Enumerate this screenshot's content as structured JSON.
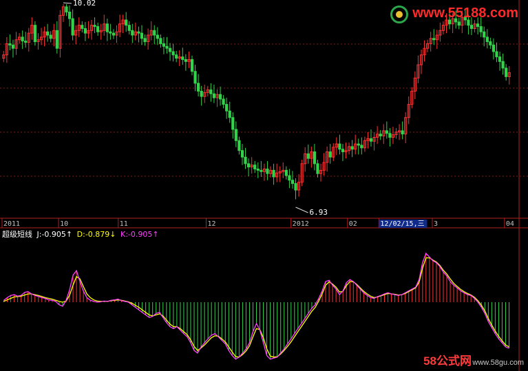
{
  "watermarks": {
    "top_site": "www.55188.com",
    "bottom_brand": "58公式网",
    "bottom_site": "www.58gu.com"
  },
  "indicator": {
    "name": "超级短线",
    "j_label": "J:-0.905↑",
    "d_label": "D:-0.879↓",
    "k_label": "K:-0.905↑"
  },
  "colors": {
    "background": "#000000",
    "up": "#ff3232",
    "down": "#32d24a",
    "grid": "#8b1a1a",
    "j_line": "#ffffff",
    "d_line": "#ffff00",
    "k_line": "#ff40ff",
    "axis_text": "#c0c0c0"
  },
  "chart_data": [
    {
      "type": "candlestick",
      "annotations": [
        {
          "label": "10.02",
          "kind": "max"
        },
        {
          "label": "6.93",
          "kind": "min"
        }
      ],
      "x_tick_labels": [
        "2011",
        "10",
        "11",
        "12",
        "2012",
        "02",
        "12/02/15,三",
        "3",
        "04"
      ],
      "x_tick_index": [
        0,
        18,
        37,
        65,
        92,
        110,
        120,
        137,
        160
      ],
      "highlighted_tick": "12/02/15,三",
      "close": [
        9.25,
        9.42,
        9.4,
        9.35,
        9.48,
        9.52,
        9.46,
        9.44,
        9.58,
        9.7,
        9.45,
        9.48,
        9.52,
        9.6,
        9.55,
        9.5,
        9.62,
        9.35,
        9.85,
        9.98,
        9.9,
        9.8,
        9.55,
        9.62,
        9.7,
        9.65,
        9.58,
        9.62,
        9.7,
        9.68,
        9.6,
        9.62,
        9.72,
        9.6,
        9.58,
        9.55,
        9.6,
        9.72,
        9.78,
        9.7,
        9.62,
        9.55,
        9.6,
        9.58,
        9.5,
        9.45,
        9.55,
        9.62,
        9.55,
        9.5,
        9.42,
        9.38,
        9.35,
        9.3,
        9.25,
        9.2,
        9.22,
        9.18,
        9.15,
        9.18,
        9.0,
        8.82,
        8.7,
        8.62,
        8.68,
        8.72,
        8.66,
        8.6,
        8.65,
        8.58,
        8.5,
        8.4,
        8.3,
        8.12,
        7.95,
        7.8,
        7.7,
        7.6,
        7.55,
        7.58,
        7.52,
        7.5,
        7.48,
        7.52,
        7.45,
        7.5,
        7.4,
        7.46,
        7.48,
        7.5,
        7.42,
        7.35,
        7.3,
        7.2,
        7.32,
        7.6,
        7.75,
        7.68,
        7.78,
        7.6,
        7.45,
        7.5,
        7.62,
        7.78,
        7.7,
        7.85,
        7.9,
        7.82,
        7.78,
        7.8,
        7.86,
        7.82,
        7.9,
        7.88,
        7.84,
        7.95,
        7.98,
        7.94,
        8.0,
        8.05,
        8.02,
        8.1,
        8.06,
        8.0,
        8.04,
        8.08,
        8.1,
        8.05,
        8.3,
        8.5,
        8.7,
        8.9,
        9.1,
        9.25,
        9.35,
        9.42,
        9.5,
        9.48,
        9.55,
        9.62,
        9.7,
        9.78,
        9.72,
        9.8,
        9.75,
        9.7,
        9.82,
        9.78,
        9.7,
        9.65,
        9.72,
        9.68,
        9.6,
        9.52,
        9.45,
        9.4,
        9.3,
        9.22,
        9.15,
        9.05,
        8.92,
        8.98
      ]
    },
    {
      "type": "line",
      "series_names": [
        "J",
        "D",
        "K"
      ],
      "final_values": {
        "J": -0.905,
        "D": -0.879,
        "K": -0.905
      },
      "zero_line_relative_y": 0.5,
      "J": [
        0.05,
        0.12,
        0.18,
        0.2,
        0.16,
        0.18,
        0.26,
        0.28,
        0.22,
        0.18,
        0.15,
        0.12,
        0.1,
        0.06,
        0.05,
        0.02,
        -0.05,
        -0.08,
        0.05,
        0.32,
        0.72,
        0.84,
        0.55,
        0.3,
        0.12,
        0.05,
        0.02,
        0.0,
        0.01,
        0.03,
        0.02,
        0.05,
        0.06,
        0.08,
        0.04,
        0.02,
        0.0,
        -0.05,
        -0.1,
        -0.15,
        -0.2,
        -0.25,
        -0.3,
        -0.28,
        -0.22,
        -0.2,
        -0.3,
        -0.4,
        -0.48,
        -0.52,
        -0.48,
        -0.55,
        -0.62,
        -0.68,
        -0.8,
        -0.95,
        -1.0,
        -0.88,
        -0.8,
        -0.72,
        -0.65,
        -0.62,
        -0.68,
        -0.75,
        -0.82,
        -0.95,
        -1.05,
        -1.12,
        -1.08,
        -1.0,
        -0.92,
        -0.8,
        -0.58,
        -0.42,
        -0.55,
        -0.8,
        -1.05,
        -1.12,
        -1.1,
        -1.08,
        -1.0,
        -0.92,
        -0.82,
        -0.72,
        -0.62,
        -0.52,
        -0.42,
        -0.32,
        -0.22,
        -0.12,
        -0.05,
        0.1,
        0.3,
        0.55,
        0.58,
        0.45,
        0.35,
        0.2,
        0.3,
        0.52,
        0.6,
        0.55,
        0.45,
        0.35,
        0.25,
        0.18,
        0.12,
        0.1,
        0.15,
        0.18,
        0.22,
        0.25,
        0.22,
        0.2,
        0.18,
        0.2,
        0.25,
        0.3,
        0.35,
        0.4,
        0.6,
        1.05,
        1.3,
        1.2,
        1.1,
        1.05,
        0.95,
        0.8,
        0.7,
        0.55,
        0.45,
        0.38,
        0.3,
        0.25,
        0.2,
        0.18,
        0.1,
        0.0,
        -0.1,
        -0.22,
        -0.38,
        -0.5,
        -0.62,
        -0.72,
        -0.8,
        -0.88,
        -0.905
      ],
      "D": [
        0.02,
        0.06,
        0.1,
        0.14,
        0.15,
        0.16,
        0.19,
        0.22,
        0.22,
        0.2,
        0.18,
        0.15,
        0.12,
        0.1,
        0.08,
        0.05,
        0.02,
        0.0,
        0.03,
        0.18,
        0.45,
        0.68,
        0.62,
        0.42,
        0.22,
        0.12,
        0.06,
        0.03,
        0.02,
        0.02,
        0.02,
        0.04,
        0.05,
        0.06,
        0.05,
        0.03,
        0.01,
        -0.02,
        -0.06,
        -0.1,
        -0.15,
        -0.2,
        -0.25,
        -0.27,
        -0.25,
        -0.23,
        -0.27,
        -0.35,
        -0.43,
        -0.48,
        -0.48,
        -0.52,
        -0.58,
        -0.64,
        -0.74,
        -0.87,
        -0.95,
        -0.9,
        -0.84,
        -0.77,
        -0.7,
        -0.66,
        -0.67,
        -0.72,
        -0.78,
        -0.88,
        -0.98,
        -1.07,
        -1.08,
        -1.03,
        -0.96,
        -0.86,
        -0.68,
        -0.52,
        -0.54,
        -0.7,
        -0.92,
        -1.06,
        -1.08,
        -1.07,
        -1.02,
        -0.95,
        -0.87,
        -0.78,
        -0.68,
        -0.58,
        -0.48,
        -0.38,
        -0.28,
        -0.18,
        -0.1,
        0.03,
        0.22,
        0.45,
        0.54,
        0.48,
        0.4,
        0.27,
        0.29,
        0.44,
        0.55,
        0.54,
        0.47,
        0.38,
        0.29,
        0.22,
        0.16,
        0.12,
        0.14,
        0.17,
        0.2,
        0.23,
        0.22,
        0.21,
        0.19,
        0.2,
        0.23,
        0.28,
        0.33,
        0.38,
        0.53,
        0.9,
        1.18,
        1.18,
        1.12,
        1.07,
        0.98,
        0.85,
        0.75,
        0.62,
        0.5,
        0.42,
        0.34,
        0.28,
        0.23,
        0.19,
        0.13,
        0.04,
        -0.06,
        -0.17,
        -0.32,
        -0.45,
        -0.57,
        -0.67,
        -0.76,
        -0.84,
        -0.879
      ]
    }
  ]
}
